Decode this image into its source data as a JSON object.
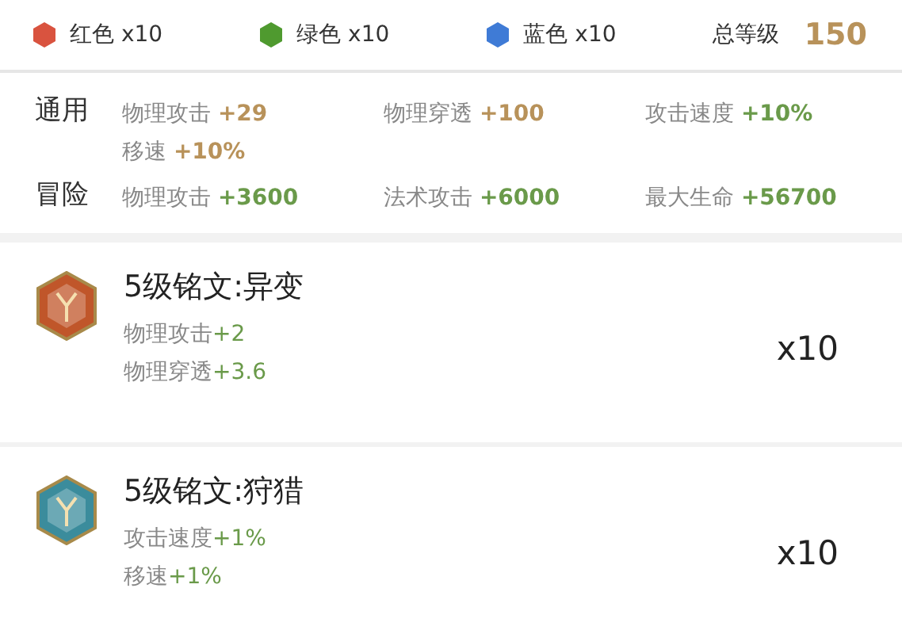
{
  "gems": [
    {
      "label": "红色 x10",
      "color": "#d9533f"
    },
    {
      "label": "绿色 x10",
      "color": "#4f9a2f"
    },
    {
      "label": "蓝色 x10",
      "color": "#3f7bd6"
    }
  ],
  "total": {
    "label": "总等级",
    "value": "150"
  },
  "stat_groups": [
    {
      "title": "通用",
      "stats": [
        {
          "name": "物理攻击",
          "value": "+29",
          "color": "#b8925a"
        },
        {
          "name": "物理穿透",
          "value": "+100",
          "color": "#b8925a"
        },
        {
          "name": "攻击速度",
          "value": "+10%",
          "color": "#6a9a4a"
        },
        {
          "name": "移速",
          "value": "+10%",
          "color": "#b8925a"
        }
      ]
    },
    {
      "title": "冒险",
      "stats": [
        {
          "name": "物理攻击",
          "value": "+3600",
          "color": "#6a9a4a"
        },
        {
          "name": "法术攻击",
          "value": "+6000",
          "color": "#6a9a4a"
        },
        {
          "name": "最大生命",
          "value": "+56700",
          "color": "#6a9a4a"
        }
      ]
    }
  ],
  "runes": [
    {
      "title": "5级铭文:异变",
      "color": "#c0562a",
      "count": "x10",
      "effects": [
        {
          "name": "物理攻击",
          "value": "+2"
        },
        {
          "name": "物理穿透",
          "value": "+3.6"
        }
      ]
    },
    {
      "title": "5级铭文:狩猎",
      "color": "#3b8c9c",
      "count": "x10",
      "effects": [
        {
          "name": "攻击速度",
          "value": "+1%"
        },
        {
          "name": "移速",
          "value": "+1%"
        }
      ]
    }
  ]
}
